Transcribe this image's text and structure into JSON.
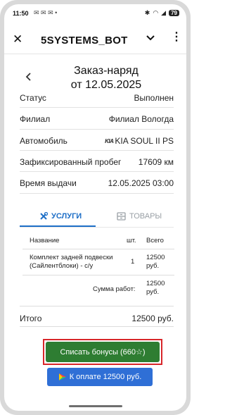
{
  "status_bar": {
    "time": "11:50",
    "left_icons": "✉ ✉ ✉ •",
    "battery": "79"
  },
  "app_bar": {
    "title": "5SYSTEMS_BOT"
  },
  "page": {
    "title_line1": "Заказ-наряд",
    "title_line2": "от 12.05.2025"
  },
  "info": [
    {
      "label": "Статус",
      "value": "Выполнен"
    },
    {
      "label": "Филиал",
      "value": "Филиал Вологда"
    },
    {
      "label": "Автомобиль",
      "value": "KIA SOUL II PS",
      "logo": "KIA"
    },
    {
      "label": "Зафиксированный пробег",
      "value": "17609 км"
    },
    {
      "label": "Время выдачи",
      "value": "12.05.2025 03:00"
    }
  ],
  "tabs": {
    "services": "УСЛУГИ",
    "goods": "ТОВАРЫ"
  },
  "services_table": {
    "headers": [
      "Название",
      "шт.",
      "Всего"
    ],
    "rows": [
      {
        "name": "Комплект задней подвески (Сайлентблоки) - с/у",
        "qty": "1",
        "total": "12500 руб."
      }
    ],
    "sum_label": "Сумма работ:",
    "sum_value": "12500 руб."
  },
  "total": {
    "label": "Итого",
    "value": "12500 руб."
  },
  "buttons": {
    "bonus": "Списать бонусы (660☆)",
    "pay": "К оплате 12500 руб."
  },
  "colors": {
    "accent": "#1e6fc7",
    "bonus_button": "#2e7d32",
    "pay_button": "#2f6fd6",
    "highlight_frame": "#d8262a"
  }
}
